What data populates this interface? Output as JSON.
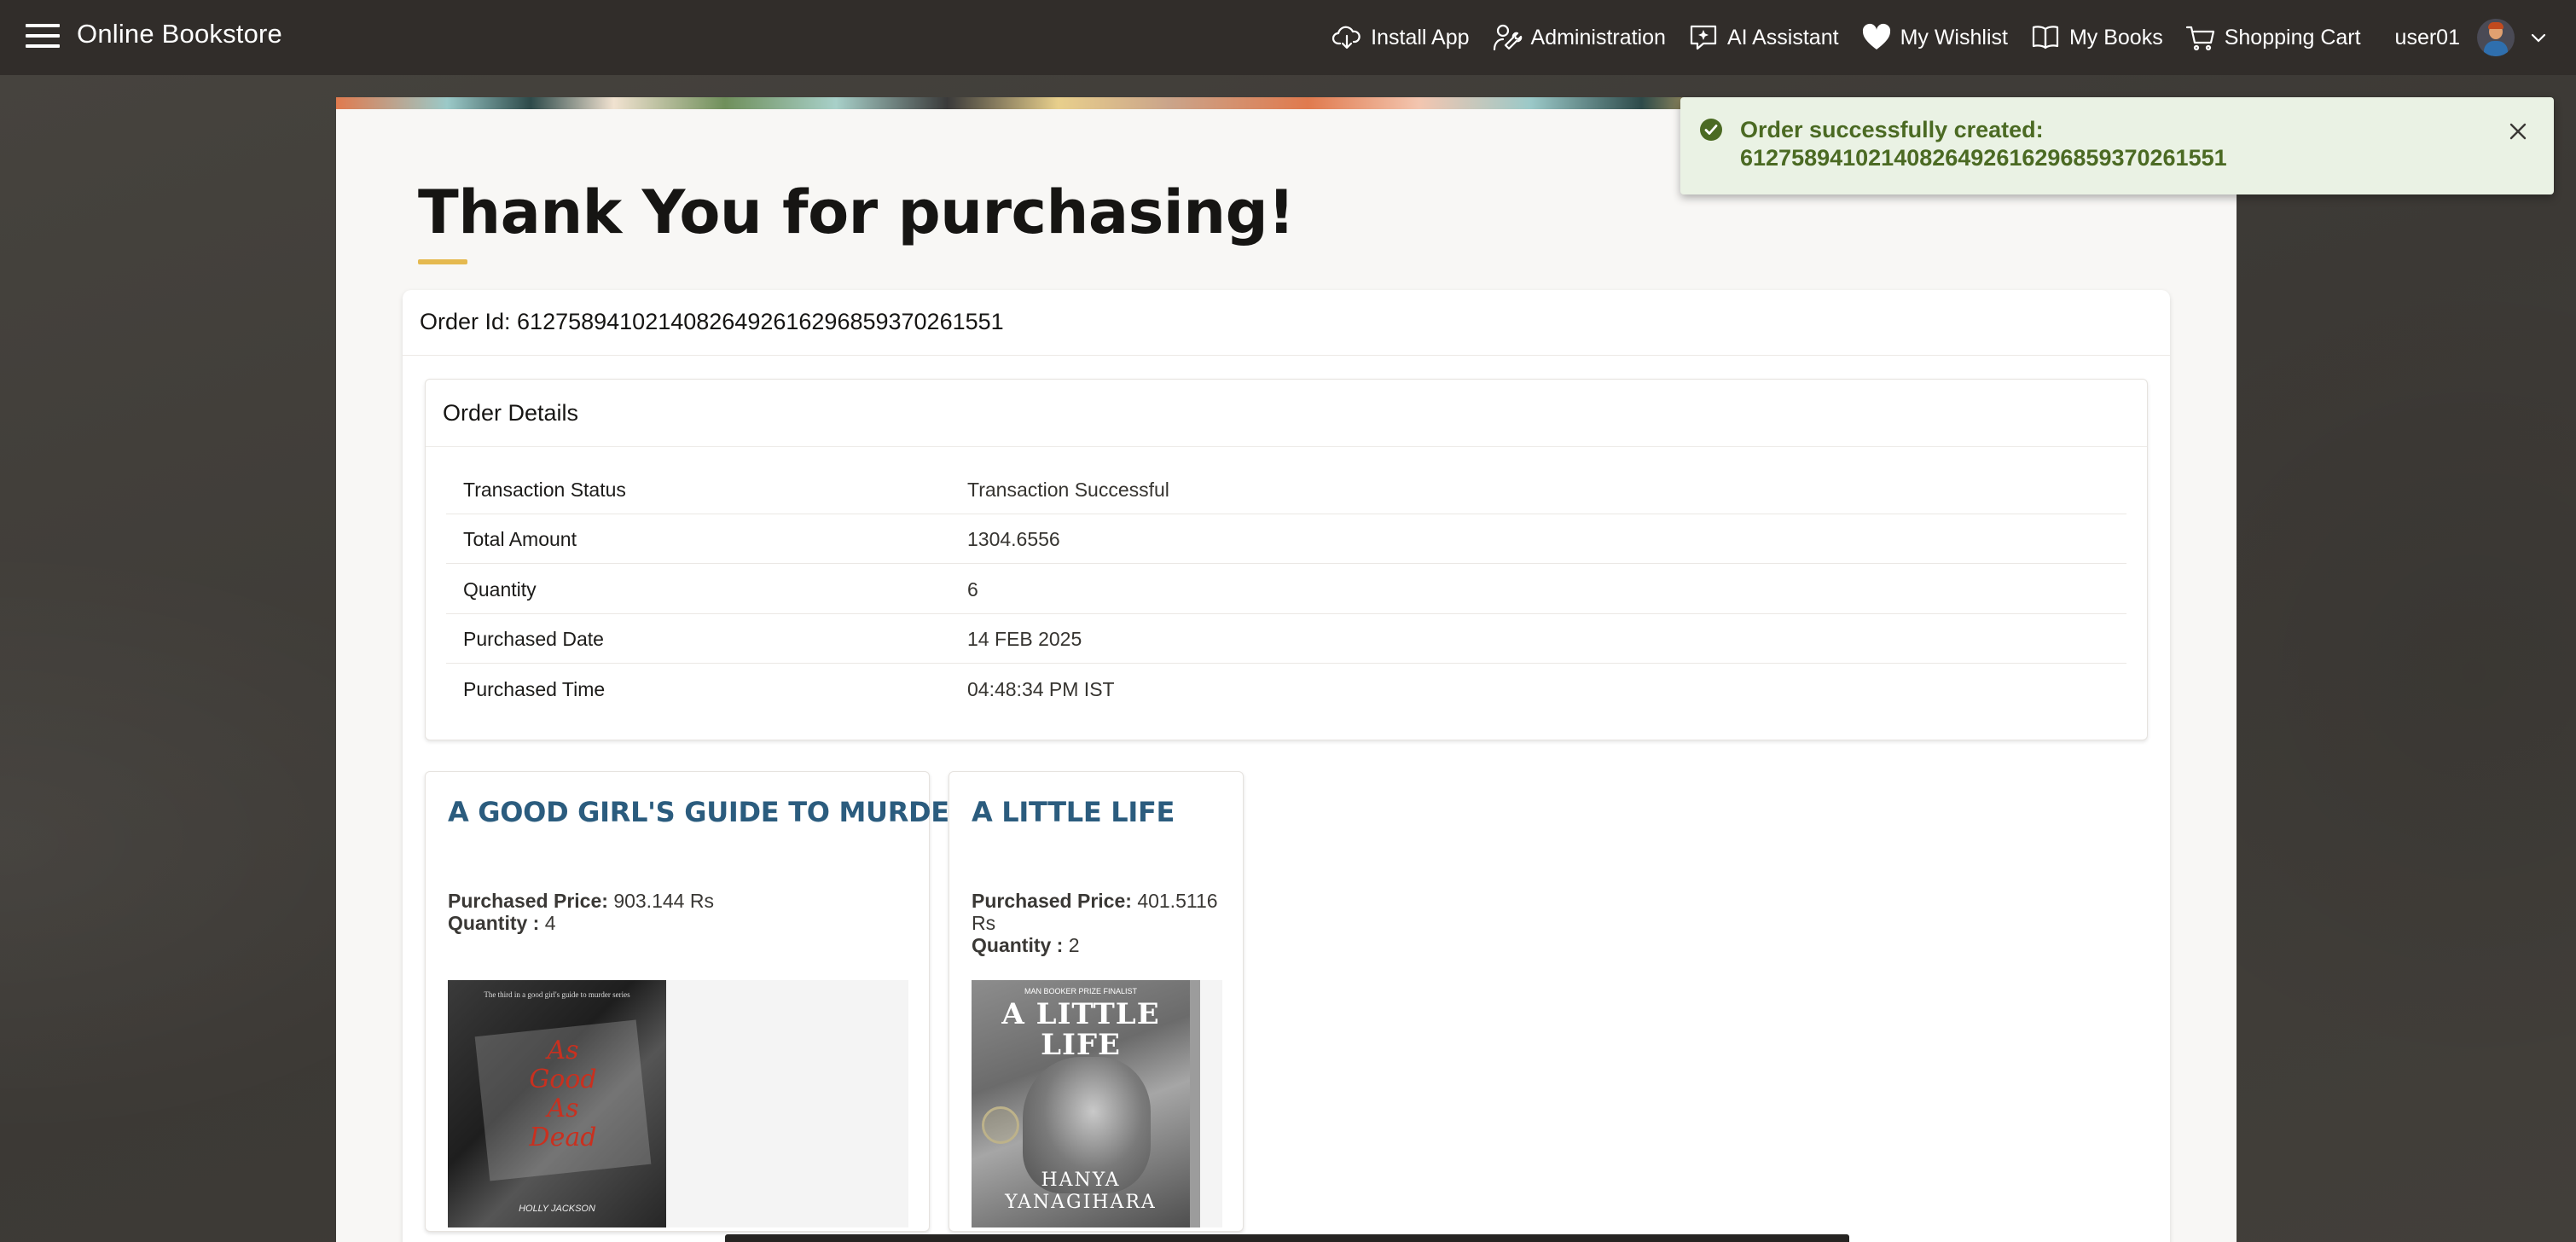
{
  "header": {
    "app_title": "Online Bookstore",
    "nav": [
      {
        "label": "Install App",
        "icon": "cloud-download-icon"
      },
      {
        "label": "Administration",
        "icon": "user-wrench-icon"
      },
      {
        "label": "AI Assistant",
        "icon": "chat-spark-icon"
      },
      {
        "label": "My Wishlist",
        "icon": "heart-icon"
      },
      {
        "label": "My Books",
        "icon": "open-book-icon"
      },
      {
        "label": "Shopping Cart",
        "icon": "cart-icon"
      }
    ],
    "username": "user01"
  },
  "page": {
    "title": "Thank You for purchasing!",
    "order_id_label": "Order Id: 612758941021408264926162968593702615 51"
  },
  "order_id_text": "Order Id: 61275894102140826492616296859370261551",
  "details": {
    "title": "Order Details",
    "rows": [
      {
        "label": "Transaction Status",
        "value": "Transaction Successful"
      },
      {
        "label": "Total Amount",
        "value": "1304.6556"
      },
      {
        "label": "Quantity",
        "value": "6"
      },
      {
        "label": "Purchased Date",
        "value": "14 FEB 2025"
      },
      {
        "label": "Purchased Time",
        "value": "04:48:34 PM IST"
      }
    ]
  },
  "books": [
    {
      "title": "A GOOD GIRL'S GUIDE TO MURDER",
      "price_label": "Purchased Price:",
      "price": "903.144 Rs",
      "qty_label": "Quantity :",
      "qty": "4",
      "cover_text": [
        "As",
        "Good",
        "As",
        "Dead"
      ],
      "cover_top": "The third in a good girl's guide to murder series",
      "cover_author": "HOLLY JACKSON"
    },
    {
      "title": "A LITTLE LIFE",
      "price_label": "Purchased Price:",
      "price": "401.5116 Rs",
      "qty_label": "Quantity :",
      "qty": "2",
      "cover_top": "MAN BOOKER PRIZE FINALIST",
      "cover_title": [
        "A LITTLE",
        "LIFE"
      ],
      "cover_author": [
        "HANYA",
        "YANAGIHARA"
      ]
    }
  ],
  "toast": {
    "line1": "Order successfully created:",
    "line2": "61275894102140826492616296859370261551"
  },
  "colors": {
    "header_bg": "#312d2a",
    "accent_gold": "#e5b94f",
    "book_title": "#2b5c7e",
    "toast_text": "#4b6a23",
    "toast_bg": "#eaf2e4",
    "success_icon": "#4b6a23"
  }
}
